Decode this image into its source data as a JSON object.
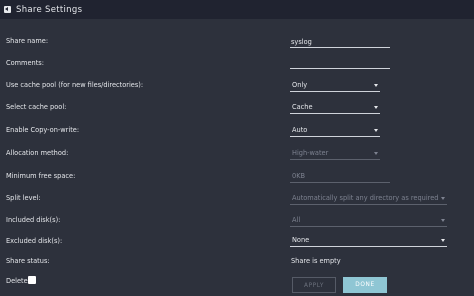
{
  "header": {
    "title": "Share Settings"
  },
  "form": {
    "share_name": {
      "label": "Share name:",
      "value": "syslog"
    },
    "comments": {
      "label": "Comments:",
      "value": ""
    },
    "use_cache": {
      "label": "Use cache pool (for new files/directories):",
      "value": "Only"
    },
    "cache_pool": {
      "label": "Select cache pool:",
      "value": "Cache"
    },
    "cow": {
      "label": "Enable Copy-on-write:",
      "value": "Auto"
    },
    "allocation": {
      "label": "Allocation method:",
      "value": "High-water"
    },
    "min_free": {
      "label": "Minimum free space:",
      "value": "0KB"
    },
    "split_level": {
      "label": "Split level:",
      "value": "Automatically split any directory as required"
    },
    "included": {
      "label": "Included disk(s):",
      "value": "All"
    },
    "excluded": {
      "label": "Excluded disk(s):",
      "value": "None"
    },
    "status": {
      "label": "Share status:",
      "value": "Share is empty"
    },
    "delete": {
      "label": "Delete"
    }
  },
  "buttons": {
    "apply": "APPLY",
    "done": "DONE"
  }
}
